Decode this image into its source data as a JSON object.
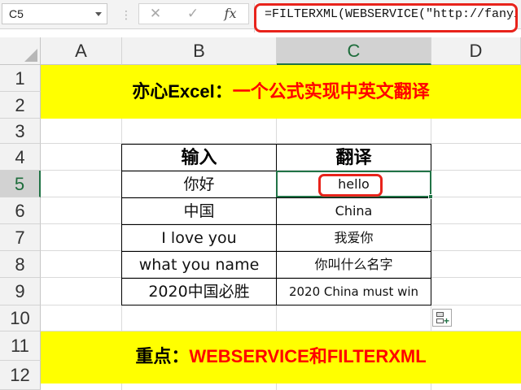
{
  "formula_bar": {
    "name_box": "C5",
    "cancel_symbol": "✕",
    "enter_symbol": "✓",
    "fx_label": "fx",
    "formula": "=FILTERXML(WEBSERVICE(\"http://fanyi.yo",
    "highlight_color": "#e8231b"
  },
  "columns": [
    "A",
    "B",
    "C",
    "D"
  ],
  "active_column": "C",
  "rows": [
    "1",
    "2",
    "3",
    "4",
    "5",
    "6",
    "7",
    "8",
    "9",
    "10",
    "11",
    "12"
  ],
  "active_row": "5",
  "title_banner": {
    "black_text": "亦心Excel：",
    "red_text": "一个公式实现中英文翻译",
    "background": "#ffff00"
  },
  "table": {
    "headers": [
      "输入",
      "翻译"
    ],
    "rows": [
      {
        "input": "你好",
        "translation": "hello"
      },
      {
        "input": "中国",
        "translation": "China"
      },
      {
        "input": "I love you",
        "translation": "我爱你"
      },
      {
        "input": "what you name",
        "translation": "你叫什么名字"
      },
      {
        "input": "2020中国必胜",
        "translation": "2020 China must win"
      }
    ]
  },
  "footer_banner": {
    "black_text": "重点：",
    "red_text": "WEBSERVICE和FILTERXML",
    "background": "#ffff00"
  },
  "active_cell": "C5",
  "quick_analysis_icon": "quick-analysis-icon"
}
